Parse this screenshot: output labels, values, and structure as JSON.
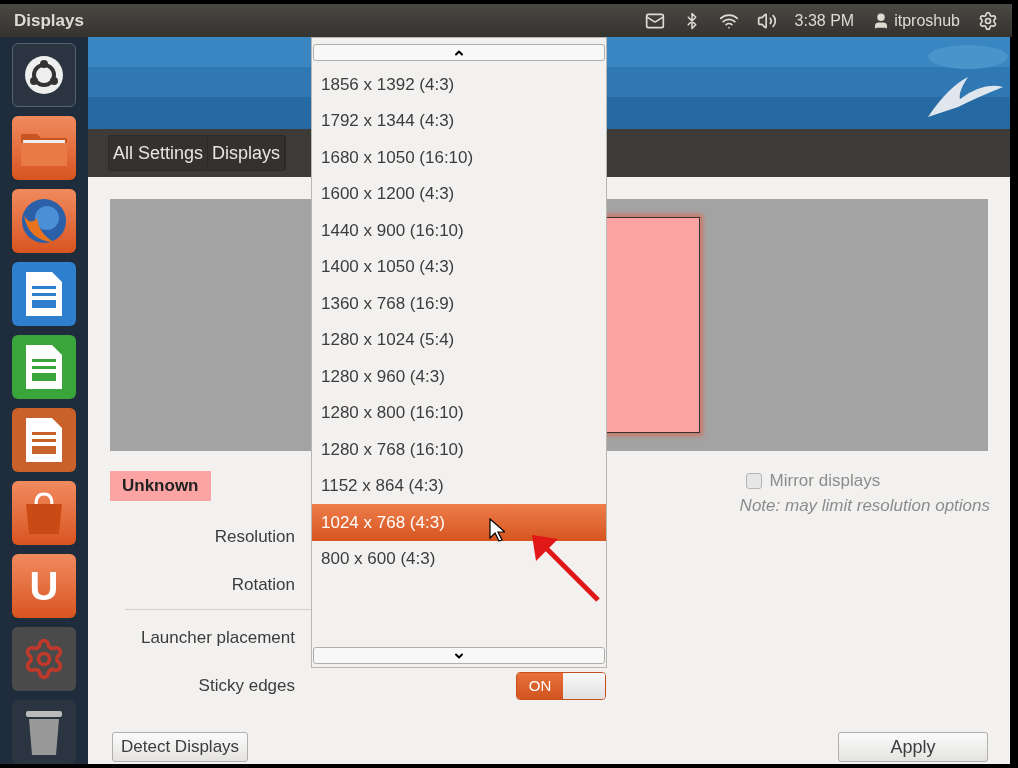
{
  "top_bar": {
    "title": "Displays",
    "clock": "3:38 PM",
    "user": "itproshub"
  },
  "launcher": [
    {
      "kind": "dash"
    },
    {
      "kind": "files"
    },
    {
      "kind": "browser"
    },
    {
      "kind": "writer"
    },
    {
      "kind": "calc"
    },
    {
      "kind": "impress"
    },
    {
      "kind": "store"
    },
    {
      "kind": "one",
      "label": "U"
    },
    {
      "kind": "settings"
    },
    {
      "kind": "trash"
    }
  ],
  "breadcrumbs": [
    {
      "label": "All Settings"
    },
    {
      "label": "Displays"
    }
  ],
  "display": {
    "name": "Unknown"
  },
  "mirror": {
    "label": "Mirror displays",
    "checked": false,
    "note": "Note: may limit resolution options"
  },
  "settings_groups": [
    {
      "rows": [
        {
          "label": "Resolution"
        },
        {
          "label": "Rotation"
        }
      ]
    },
    {
      "rows": [
        {
          "label": "Launcher placement"
        },
        {
          "label": "Sticky edges"
        }
      ]
    }
  ],
  "sticky_switch": {
    "on": true,
    "label": "ON"
  },
  "resolution_menu": [
    {
      "label": "1856 x 1392 (4:3)",
      "selected": false
    },
    {
      "label": "1792 x 1344 (4:3)",
      "selected": false
    },
    {
      "label": "1680 x 1050 (16:10)",
      "selected": false
    },
    {
      "label": "1600 x 1200 (4:3)",
      "selected": false
    },
    {
      "label": "1440 x 900 (16:10)",
      "selected": false
    },
    {
      "label": "1400 x 1050 (4:3)",
      "selected": false
    },
    {
      "label": "1360 x 768 (16:9)",
      "selected": false
    },
    {
      "label": "1280 x 1024 (5:4)",
      "selected": false
    },
    {
      "label": "1280 x 960 (4:3)",
      "selected": false
    },
    {
      "label": "1280 x 800 (16:10)",
      "selected": false
    },
    {
      "label": "1280 x 768 (16:10)",
      "selected": false
    },
    {
      "label": "1152 x 864 (4:3)",
      "selected": false
    },
    {
      "label": "1024 x 768 (4:3)",
      "selected": true
    },
    {
      "label": "800 x 600 (4:3)",
      "selected": false
    }
  ],
  "buttons": {
    "detect": "Detect Displays",
    "apply": "Apply"
  }
}
